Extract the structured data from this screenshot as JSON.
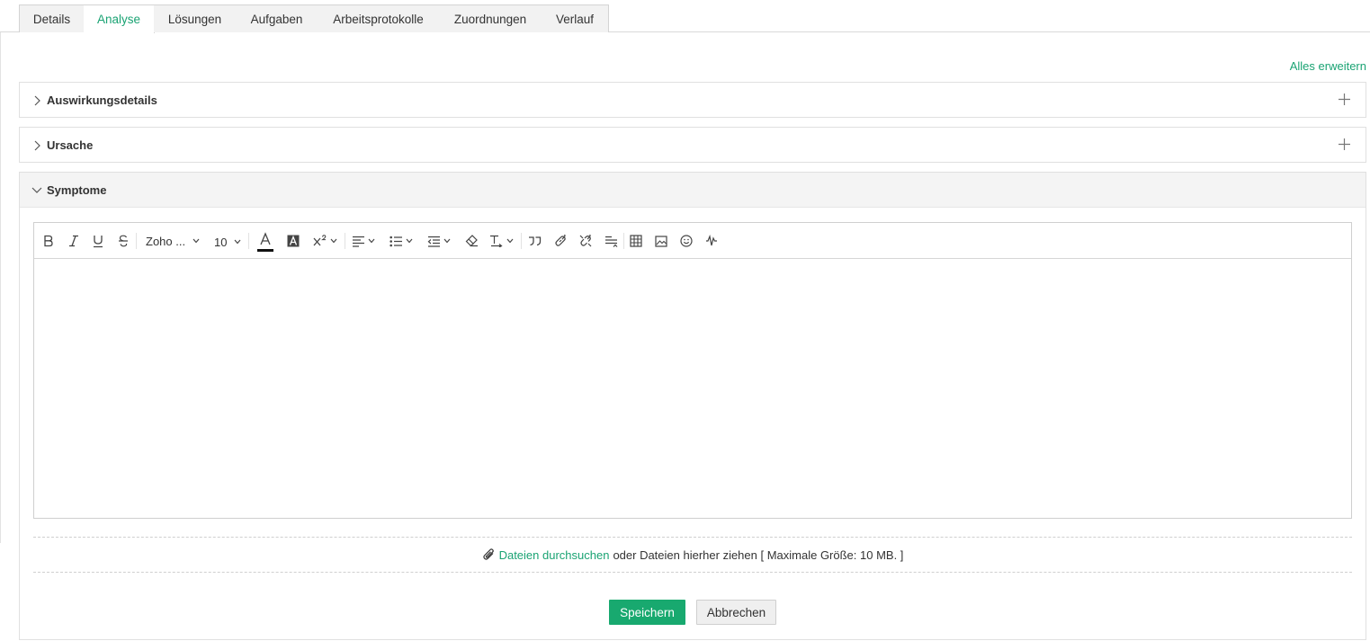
{
  "tabs": [
    {
      "label": "Details"
    },
    {
      "label": "Analyse",
      "active": true
    },
    {
      "label": "Lösungen"
    },
    {
      "label": "Aufgaben"
    },
    {
      "label": "Arbeitsprotokolle"
    },
    {
      "label": "Zuordnungen"
    },
    {
      "label": "Verlauf"
    }
  ],
  "expand_all_label": "Alles erweitern",
  "sections": [
    {
      "title": "Auswirkungsdetails",
      "expanded": false
    },
    {
      "title": "Ursache",
      "expanded": false
    },
    {
      "title": "Symptome",
      "expanded": true
    }
  ],
  "editor": {
    "font_name": "Zoho ...",
    "font_size": "10",
    "tools": [
      "bold-icon",
      "italic-icon",
      "underline-icon",
      "strikethrough-icon",
      "font-family-select",
      "font-size-select",
      "text-color-icon",
      "background-color-icon",
      "superscript-icon",
      "align-icon",
      "list-icon",
      "indent-icon",
      "clear-format-icon",
      "text-direction-icon",
      "quote-icon",
      "link-icon",
      "unlink-icon",
      "line-spacing-icon",
      "table-icon",
      "image-icon",
      "emoji-icon",
      "audio-icon"
    ]
  },
  "attachment": {
    "browse_label": "Dateien durchsuchen",
    "drop_text": "oder Dateien hierher ziehen [ Maximale Größe: 10 MB. ]"
  },
  "buttons": {
    "save": "Speichern",
    "cancel": "Abbrechen"
  },
  "colors": {
    "accent": "#1aa373",
    "primary_button": "#18a96f"
  }
}
